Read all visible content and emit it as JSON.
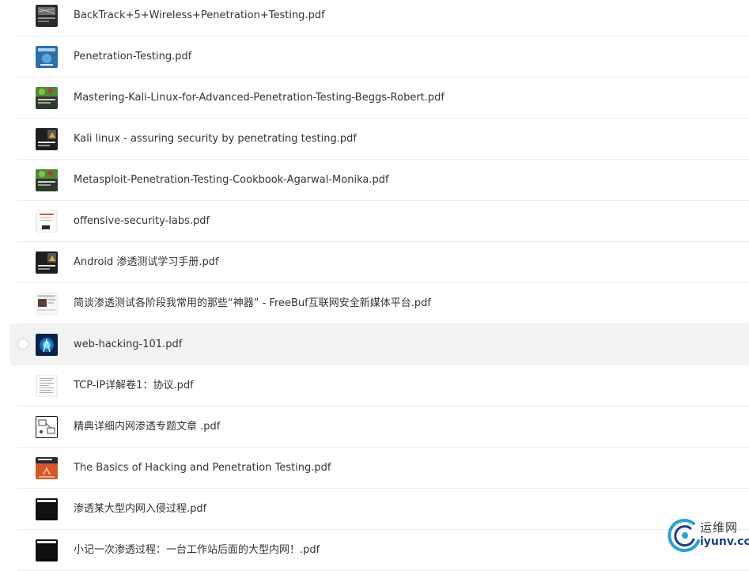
{
  "files": [
    {
      "name": "BackTrack+5+Wireless+Penetration+Testing.pdf",
      "thumb": "bt5-cover-icon"
    },
    {
      "name": "Penetration-Testing.pdf",
      "thumb": "blue-book-cover-icon"
    },
    {
      "name": "Mastering-Kali-Linux-for-Advanced-Penetration-Testing-Beggs-Robert.pdf",
      "thumb": "green-book-cover-icon"
    },
    {
      "name": "Kali linux - assuring security by penetrating testing.pdf",
      "thumb": "dark-book-cover-icon"
    },
    {
      "name": "Metasploit-Penetration-Testing-Cookbook-Agarwal-Monika.pdf",
      "thumb": "green-book-cover-icon"
    },
    {
      "name": "offensive-security-labs.pdf",
      "thumb": "document-page-icon"
    },
    {
      "name": "Android 渗透测试学习手册.pdf",
      "thumb": "dark-book-cover-icon"
    },
    {
      "name": "简谈渗透测试各阶段我常用的那些“神器” - FreeBuf互联网安全新媒体平台.pdf",
      "thumb": "webpage-screenshot-icon"
    },
    {
      "name": "web-hacking-101.pdf",
      "thumb": "cyber-cover-icon",
      "hovered": true
    },
    {
      "name": "TCP-IP详解卷1：协议.pdf",
      "thumb": "text-page-icon"
    },
    {
      "name": "精典详细内网渗透专题文章 .pdf",
      "thumb": "diagram-page-icon"
    },
    {
      "name": "The Basics of Hacking and Penetration Testing.pdf",
      "thumb": "orange-book-cover-icon"
    },
    {
      "name": "渗透某大型内网入侵过程.pdf",
      "thumb": "black-screen-icon"
    },
    {
      "name": "小记一次渗透过程：一台工作站后面的大型内网！.pdf",
      "thumb": "black-screen-icon"
    }
  ],
  "watermark": {
    "cn": "运维网",
    "en": "iyunv.com",
    "colors": {
      "ring_outer": "#2a9fd8",
      "ring_inner": "#1a3f8a"
    }
  },
  "colors": {
    "text": "#333333",
    "divider": "#ececec",
    "hover_bg": "#f2f2f2"
  }
}
